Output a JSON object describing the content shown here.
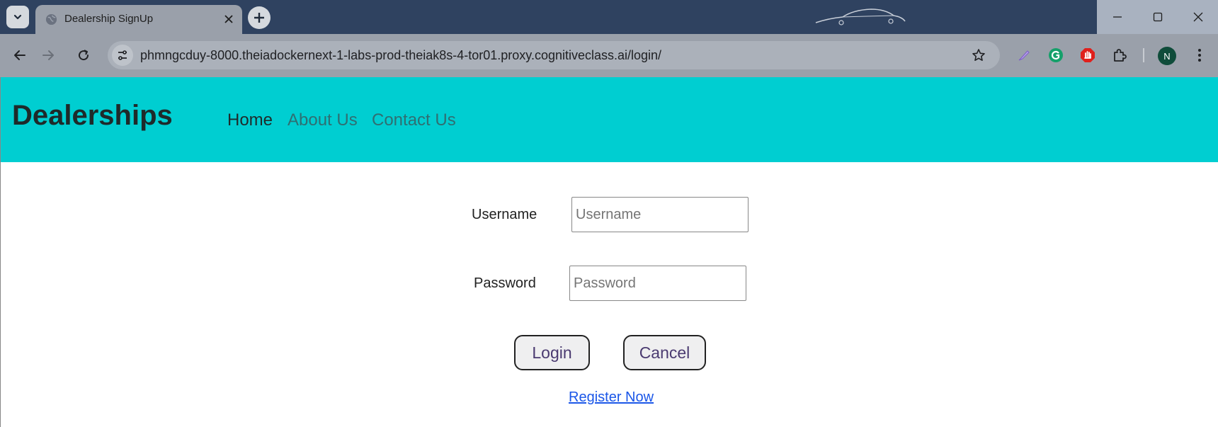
{
  "browser": {
    "tab_title": "Dealership SignUp",
    "url": "phmngcduy-8000.theiadockernext-1-labs-prod-theiak8s-4-tor01.proxy.cognitiveclass.ai/login/",
    "profile_initial": "N"
  },
  "navbar": {
    "brand": "Dealerships",
    "links": [
      "Home",
      "About Us",
      "Contact Us"
    ],
    "background_color": "#00ced1"
  },
  "form": {
    "username_label": "Username",
    "username_placeholder": "Username",
    "username_value": "",
    "password_label": "Password",
    "password_placeholder": "Password",
    "password_value": "",
    "login_button": "Login",
    "cancel_button": "Cancel",
    "register_link": "Register Now"
  }
}
